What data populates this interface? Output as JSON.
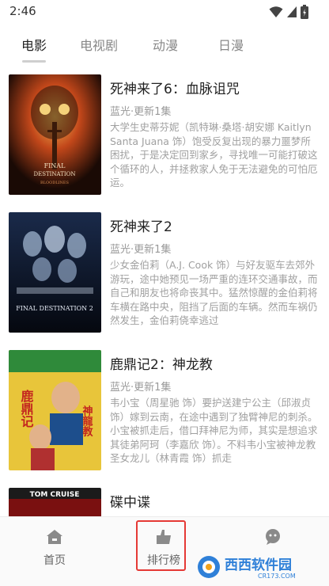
{
  "status_bar": {
    "time": "2:46"
  },
  "tabs": [
    {
      "label": "电影",
      "active": true
    },
    {
      "label": "电视剧",
      "active": false
    },
    {
      "label": "动漫",
      "active": false
    },
    {
      "label": "日漫",
      "active": false
    }
  ],
  "items": [
    {
      "title": "死神来了6：血脉诅咒",
      "meta": "蓝光·更新1集",
      "description": "大学生史蒂芬妮（凯特琳·桑塔·胡安娜 Kaitlyn Santa Juana 饰）饱受反复出现的暴力噩梦所困扰，于是决定回到家乡，寻找唯一可能打破这个循环的人，并拯救家人免于无法避免的可怕厄运。",
      "poster_text": [
        "FINAL",
        "DESTINATION",
        "BLOODLINES"
      ]
    },
    {
      "title": "死神来了2",
      "meta": "蓝光·更新1集",
      "description": "少女金伯莉（A.J. Cook 饰）与好友驱车去郊外游玩，途中她预见一场严重的连环交通事故，而自己和朋友也将命丧其中。猛然惊醒的金伯莉将车横在路中央，阻挡了后面的车辆。然而车祸仍然发生，金伯莉侥幸逃过",
      "poster_text": [
        "FINAL DESTINATION 2"
      ]
    },
    {
      "title": "鹿鼎记2：神龙教",
      "meta": "蓝光·更新1集",
      "description": "韦小宝（周星驰 饰）要护送建宁公主（邱淑贞 饰）嫁到云南，在途中遇到了独臂神尼的刺杀。小宝被抓走后，借口拜神尼为师，其实是想追求其徒弟阿珂（李嘉欣 饰）。不料韦小宝被神龙教圣女龙儿（林青霞 饰）抓走",
      "poster_text": [
        "鹿鼎记",
        "神龍教"
      ]
    },
    {
      "title": "碟中谍",
      "meta": "",
      "description": "",
      "poster_text": [
        "TOM CRUISE"
      ]
    }
  ],
  "bottom_nav": [
    {
      "label": "首页",
      "icon": "home-icon"
    },
    {
      "label": "排行榜",
      "icon": "ranking-icon"
    },
    {
      "label": "",
      "icon": "chat-icon"
    }
  ],
  "watermark": {
    "text": "西西软件园",
    "sub": "CR173.COM"
  },
  "colors": {
    "accent_highlight": "#e53935",
    "nav_icon": "#8a8a8a",
    "watermark": "#2f80d8"
  }
}
